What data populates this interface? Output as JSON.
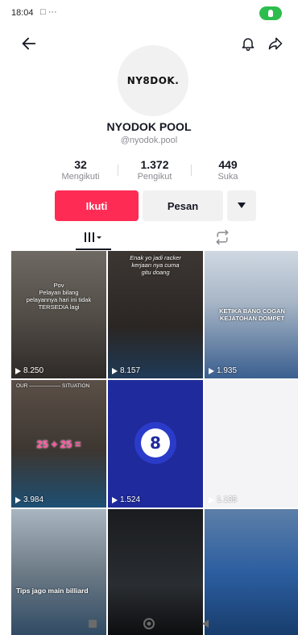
{
  "status_bar": {
    "time": "18:04",
    "extra": "□ ···"
  },
  "profile": {
    "avatar_text": "NY8DOK.",
    "display_name": "NYODOK POOL",
    "handle": "@nyodok.pool"
  },
  "stats": [
    {
      "value": "32",
      "label": "Mengikuti"
    },
    {
      "value": "1.372",
      "label": "Pengikut"
    },
    {
      "value": "449",
      "label": "Suka"
    }
  ],
  "actions": {
    "follow": "Ikuti",
    "message": "Pesan"
  },
  "videos": [
    {
      "caption": "Pov\nPelayan bilang\npelayannya hari ini tidak\nTERSEDIA lagi",
      "views": "8.250"
    },
    {
      "caption": "Enak yo jadi racker\nkerjaan nya cuma\ngitu doang",
      "views": "8.157"
    },
    {
      "caption": "KETIKA BANG COGAN\nKEJATOHAN DOMPET",
      "views": "1.935"
    },
    {
      "caption": "OUR —————— SITUATION",
      "extra": "25 + 25 =",
      "views": "3.984"
    },
    {
      "caption": "",
      "views": "1.524"
    },
    {
      "caption": "",
      "views": "1.135"
    },
    {
      "caption": "Tips jago main billiard",
      "views": ""
    },
    {
      "caption": "",
      "views": ""
    },
    {
      "caption": "",
      "views": ""
    }
  ],
  "colors": {
    "accent": "#fe2c55",
    "status_green": "#2dbd4e"
  }
}
